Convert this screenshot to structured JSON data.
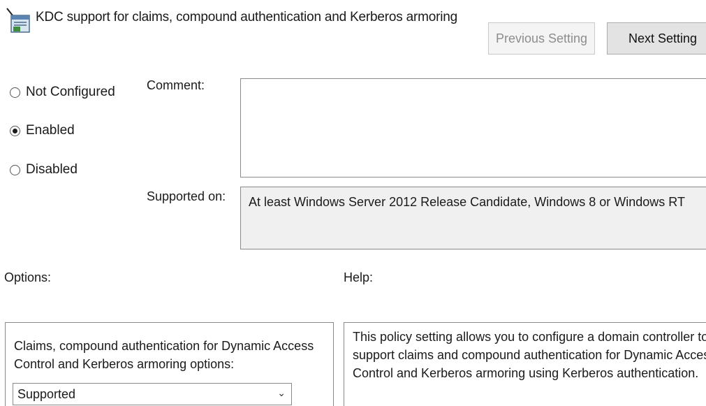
{
  "header": {
    "title": "KDC support for claims, compound authentication and Kerberos armoring",
    "previous_label": "Previous Setting",
    "next_label": "Next Setting"
  },
  "state": {
    "options": [
      {
        "label": "Not Configured",
        "checked": false
      },
      {
        "label": "Enabled",
        "checked": true
      },
      {
        "label": "Disabled",
        "checked": false
      }
    ]
  },
  "comment": {
    "label": "Comment:",
    "value": ""
  },
  "supported": {
    "label": "Supported on:",
    "value": "At least Windows Server 2012 Release Candidate, Windows 8 or Windows RT"
  },
  "options_section": {
    "label": "Options:",
    "description": "Claims, compound authentication for Dynamic Access Control and Kerberos armoring options:",
    "dropdown_value": "Supported"
  },
  "help_section": {
    "label": "Help:",
    "text": "This policy setting allows you to configure a domain controller to support claims and compound authentication for Dynamic Access Control and Kerberos armoring using Kerberos authentication."
  },
  "icons": {
    "policy": "policy-setting-icon",
    "dropdown": "chevron-down-icon"
  }
}
